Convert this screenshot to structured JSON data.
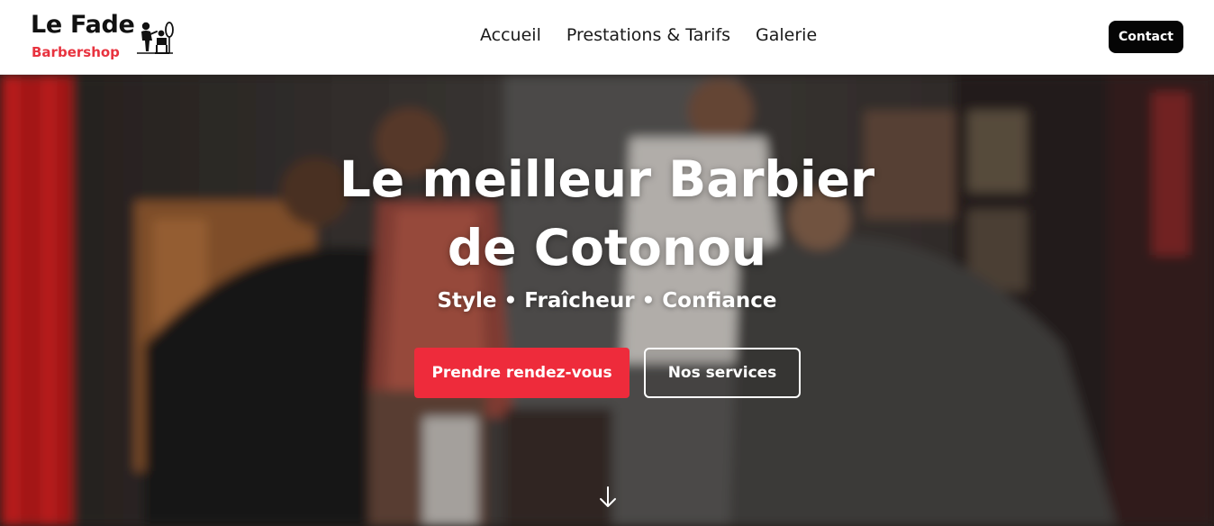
{
  "header": {
    "brand_name": "Le Fade",
    "brand_sub": "Barbershop",
    "nav": [
      {
        "label": "Accueil"
      },
      {
        "label": "Prestations & Tarifs"
      },
      {
        "label": "Galerie"
      }
    ],
    "contact_label": "Contact"
  },
  "hero": {
    "title_line1": "Le meilleur Barbier",
    "title_line2": "de Cotonou",
    "tagline": "Style • Fraîcheur • Confiance",
    "primary_cta": "Prendre rendez-vous",
    "secondary_cta": "Nos services"
  },
  "icons": {
    "logo": "barber-chair-logo-icon",
    "scroll": "arrow-down-icon"
  },
  "colors": {
    "accent": "#ee2b3b",
    "brand_sub": "#e8333f",
    "contact_bg": "#050505"
  }
}
